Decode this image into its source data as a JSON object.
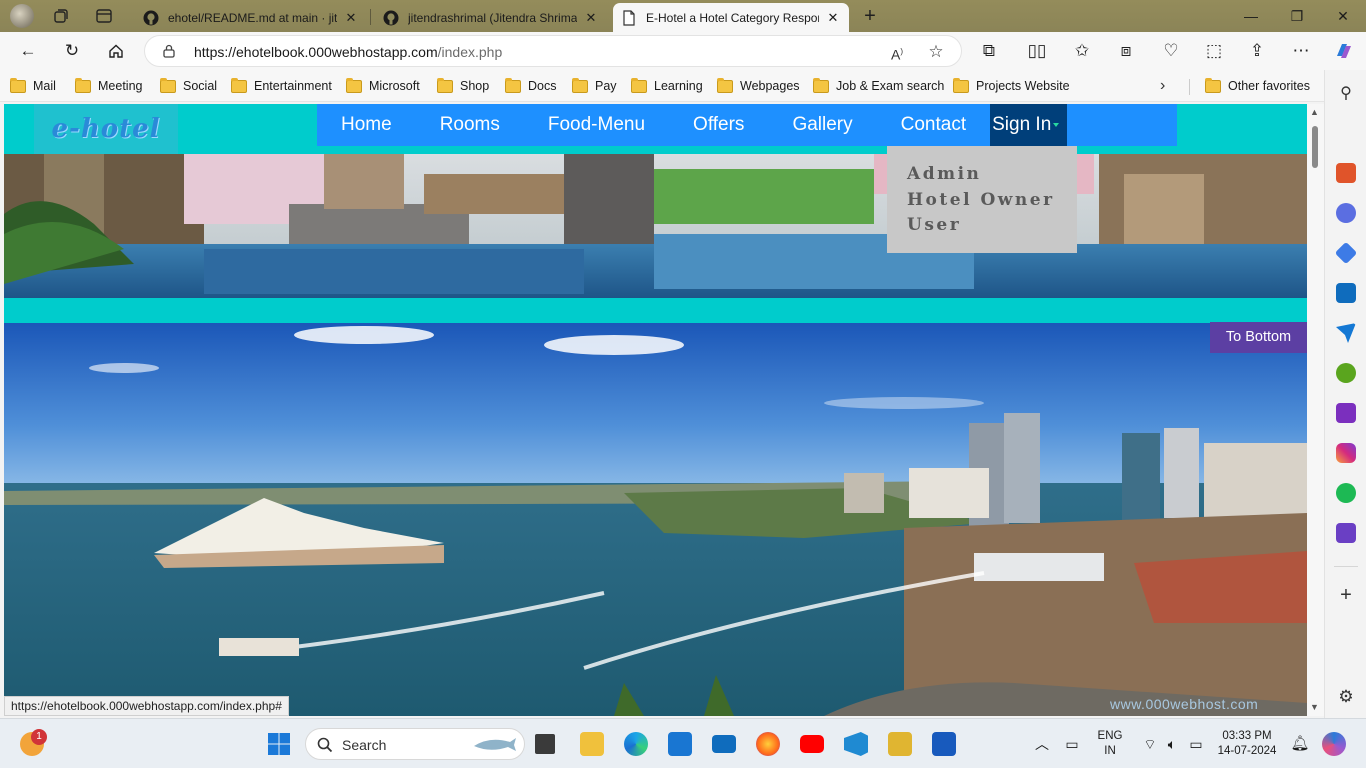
{
  "browser": {
    "tabs": [
      {
        "title": "ehotel/README.md at main · jite",
        "favicon": "github-icon"
      },
      {
        "title": "jitendrashrimal (Jitendra Shrimal)",
        "favicon": "github-icon"
      },
      {
        "title": "E-Hotel a Hotel Category Respon",
        "favicon": "page-icon",
        "active": true
      }
    ],
    "new_tab": "+",
    "url_host": "https://ehotelbook.000webhostapp.com",
    "url_path": "/index.php",
    "favorites": [
      "Mail",
      "Meeting",
      "Social",
      "Entertainment",
      "Microsoft",
      "Shop",
      "Docs",
      "Pay",
      "Learning",
      "Webpages",
      "Job & Exam search",
      "Projects Website"
    ],
    "other_favorites": "Other favorites",
    "status_url": "https://ehotelbook.000webhostapp.com/index.php#"
  },
  "site": {
    "logo": "e-hotel",
    "menu": [
      "Home",
      "Rooms",
      "Food-Menu",
      "Offers",
      "Gallery",
      "Contact"
    ],
    "signin": "Sign In",
    "signin_dropdown": [
      "Admin",
      "Hotel Owner",
      "User"
    ],
    "to_bottom": "To Bottom",
    "watermark": "www.000webhost.com"
  },
  "taskbar": {
    "search_placeholder": "Search",
    "notification_count": "1",
    "lang_line1": "ENG",
    "lang_line2": "IN",
    "time": "03:33 PM",
    "date": "14-07-2024"
  }
}
